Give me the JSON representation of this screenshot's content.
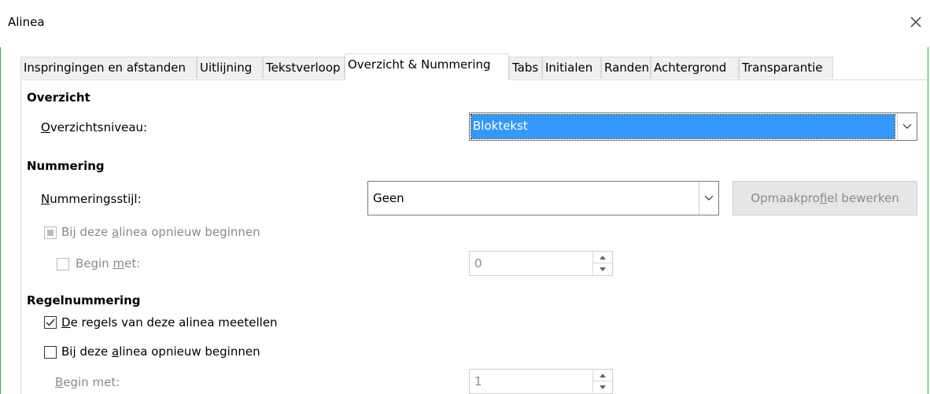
{
  "window": {
    "title": "Alinea"
  },
  "tabs": [
    {
      "label": "Inspringingen en afstanden"
    },
    {
      "label": "Uitlijning"
    },
    {
      "label": "Tekstverloop"
    },
    {
      "label": "Overzicht & Nummering"
    },
    {
      "label": "Tabs"
    },
    {
      "label": "Initialen"
    },
    {
      "label": "Randen"
    },
    {
      "label": "Achtergrond"
    },
    {
      "label": "Transparantie"
    }
  ],
  "active_tab": "Overzicht & Nummering",
  "overview": {
    "heading": "Overzicht",
    "level_label_u": "O",
    "level_label_rest": "verzichtsniveau:",
    "level_value": "Bloktekst"
  },
  "numbering": {
    "heading": "Nummering",
    "style_label_u": "N",
    "style_label_rest": "ummeringsstijl:",
    "style_value": "Geen",
    "edit_style_pre": "Opmaakpro",
    "edit_style_u": "f",
    "edit_style_post": "iel bewerken",
    "restart_pre": "Bij deze ",
    "restart_u": "a",
    "restart_post": "linea opnieuw beginnen",
    "start_pre": "Begin ",
    "start_u": "m",
    "start_post": "et:",
    "start_value": "0"
  },
  "line_numbering": {
    "heading": "Regelnummering",
    "count_u": "D",
    "count_rest": "e regels van deze alinea meetellen",
    "count_checked": true,
    "restart_pre": "Bij deze ",
    "restart_u": "a",
    "restart_post": "linea opnieuw beginnen",
    "start_u": "B",
    "start_rest": "egin met:",
    "start_value": "1"
  },
  "colors": {
    "highlight": "#3399ff",
    "frame": "#2fa84f",
    "disabled_text": "#8a8a8a"
  }
}
